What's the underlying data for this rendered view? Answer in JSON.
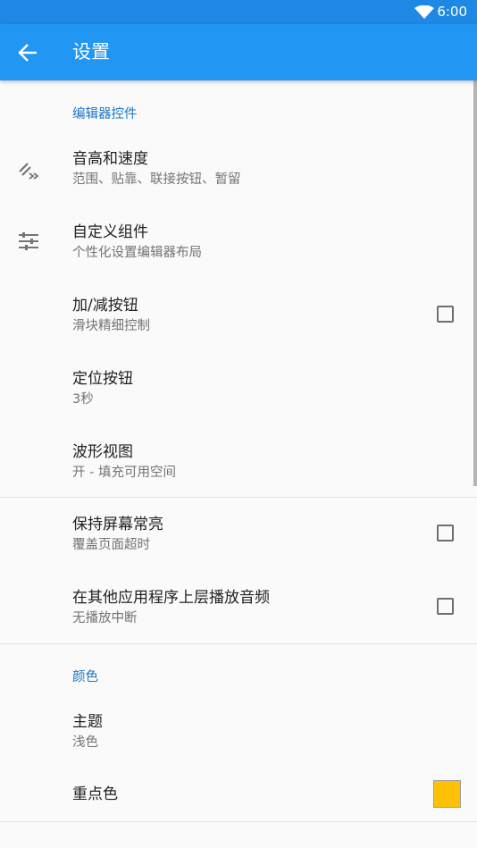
{
  "status_bar": {
    "time": "6:00",
    "wifi_icon": "wifi-icon"
  },
  "app_bar": {
    "title": "设置",
    "back_icon": "arrow-back-icon"
  },
  "sections": {
    "editor": {
      "header": "编辑器控件"
    },
    "colors": {
      "header": "颜色"
    }
  },
  "settings": {
    "pitch_speed": {
      "title": "音高和速度",
      "summary": "范围、贴靠、联接按钮、暂留",
      "icon": "pitch-speed-icon"
    },
    "custom_components": {
      "title": "自定义组件",
      "summary": "个性化设置编辑器布局",
      "icon": "tune-sliders-icon"
    },
    "plus_minus": {
      "title": "加/减按钮",
      "summary": "滑块精细控制",
      "checked": false
    },
    "locate_button": {
      "title": "定位按钮",
      "summary": "3秒"
    },
    "waveform": {
      "title": "波形视图",
      "summary": "开 - 填充可用空间"
    },
    "keep_screen_on": {
      "title": "保持屏幕常亮",
      "summary": "覆盖页面超时",
      "checked": false
    },
    "play_over_apps": {
      "title": "在其他应用程序上层播放音频",
      "summary": "无播放中断",
      "checked": false
    },
    "theme": {
      "title": "主题",
      "summary": "浅色"
    },
    "accent_color": {
      "title": "重点色",
      "value": "#ffc107"
    }
  },
  "colors": {
    "primary": "#2196f3",
    "primary_dark": "#1e88e5",
    "section_header": "#1e76c4",
    "accent_swatch": "#ffc107"
  }
}
